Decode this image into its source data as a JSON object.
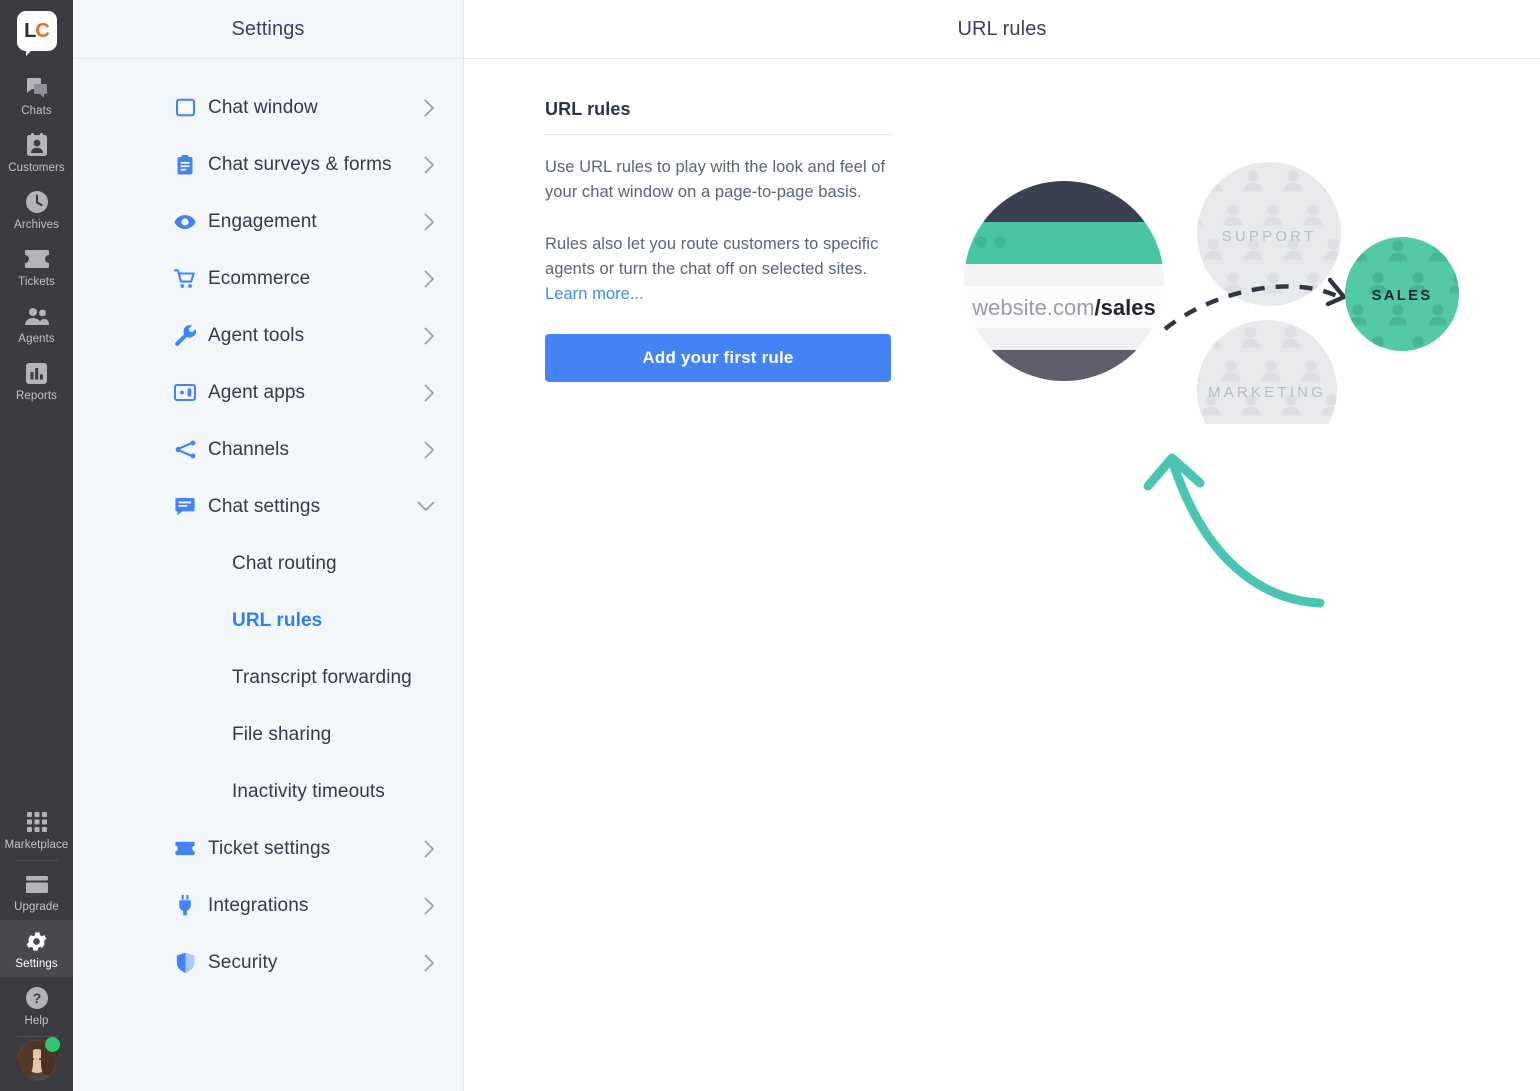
{
  "rail": {
    "logo": {
      "text_left": "L",
      "text_right": "C",
      "name": "livechat-logo"
    },
    "items": [
      {
        "label": "Chats",
        "icon": "chats-icon",
        "active": false
      },
      {
        "label": "Customers",
        "icon": "customers-icon",
        "active": false
      },
      {
        "label": "Archives",
        "icon": "archives-icon",
        "active": false
      },
      {
        "label": "Tickets",
        "icon": "tickets-icon",
        "active": false
      },
      {
        "label": "Agents",
        "icon": "agents-icon",
        "active": false
      },
      {
        "label": "Reports",
        "icon": "reports-icon",
        "active": false
      }
    ],
    "bottom_items": [
      {
        "label": "Marketplace",
        "icon": "marketplace-icon",
        "active": false
      },
      {
        "label": "Upgrade",
        "icon": "upgrade-icon",
        "active": false
      },
      {
        "label": "Settings",
        "icon": "gear-icon",
        "active": true
      },
      {
        "label": "Help",
        "icon": "help-icon",
        "active": false
      }
    ]
  },
  "settings_panel": {
    "header_title": "Settings",
    "menu": [
      {
        "label": "Chat window",
        "icon": "chat-window-icon",
        "chevron": "right",
        "level": "top"
      },
      {
        "label": "Chat surveys & forms",
        "icon": "clipboard-icon",
        "chevron": "right",
        "level": "top"
      },
      {
        "label": "Engagement",
        "icon": "eye-icon",
        "chevron": "right",
        "level": "top"
      },
      {
        "label": "Ecommerce",
        "icon": "cart-icon",
        "chevron": "right",
        "level": "top"
      },
      {
        "label": "Agent tools",
        "icon": "wrench-icon",
        "chevron": "right",
        "level": "top"
      },
      {
        "label": "Agent apps",
        "icon": "agent-apps-icon",
        "chevron": "right",
        "level": "top"
      },
      {
        "label": "Channels",
        "icon": "channels-icon",
        "chevron": "right",
        "level": "top"
      },
      {
        "label": "Chat settings",
        "icon": "chat-settings-icon",
        "chevron": "down",
        "level": "top",
        "expanded": true
      },
      {
        "label": "Chat routing",
        "icon": "",
        "chevron": "",
        "level": "sub"
      },
      {
        "label": "URL rules",
        "icon": "",
        "chevron": "",
        "level": "sub",
        "active": true
      },
      {
        "label": "Transcript forwarding",
        "icon": "",
        "chevron": "",
        "level": "sub"
      },
      {
        "label": "File sharing",
        "icon": "",
        "chevron": "",
        "level": "sub"
      },
      {
        "label": "Inactivity timeouts",
        "icon": "",
        "chevron": "",
        "level": "sub"
      },
      {
        "label": "Ticket settings",
        "icon": "ticket-icon",
        "chevron": "right",
        "level": "top"
      },
      {
        "label": "Integrations",
        "icon": "plug-icon",
        "chevron": "right",
        "level": "top"
      },
      {
        "label": "Security",
        "icon": "shield-icon",
        "chevron": "right",
        "level": "top"
      }
    ]
  },
  "main": {
    "header_title": "URL rules",
    "section_title": "URL rules",
    "paragraph_1": "Use URL rules to play with the look and feel of your chat window on a page-to-page basis.",
    "paragraph_2": "Rules also let you route customers to specific agents or turn the chat off on selected sites.",
    "learn_more": "Learn more...",
    "cta_label": "Add your first rule"
  },
  "illustration": {
    "browser_url_domain": "website.com",
    "browser_url_path": "/sales",
    "group_support": "SUPPORT",
    "group_marketing": "MARKETING",
    "group_sales": "SALES"
  },
  "colors": {
    "accent_blue": "#4384f5",
    "link_blue": "#3d8bf2",
    "active_nav_blue": "#2f7ff0",
    "rail_bg": "#3c3b41",
    "rail_active": "#4a484f",
    "panel_bg": "#f4f7f9",
    "mint_green": "#4ac5a3",
    "teal_arrow": "#4ac5b2",
    "illustration_gray": "#e6e8ea",
    "browser_dark": "#3b4150",
    "browser_slate": "#605e6c",
    "status_online": "#2dc76d"
  }
}
